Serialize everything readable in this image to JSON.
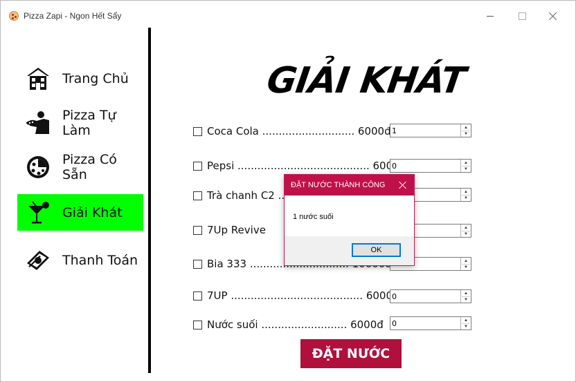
{
  "window": {
    "title": "Pizza Zapi - Ngon Hết Sẩy"
  },
  "sidebar": {
    "items": [
      {
        "label": "Trang Chủ",
        "icon": "house-icon",
        "active": false
      },
      {
        "label": "Pizza Tự Làm",
        "icon": "chef-icon",
        "active": false
      },
      {
        "label": "Pizza Có Sẵn",
        "icon": "pizza-icon",
        "active": false
      },
      {
        "label": "Giải Khát",
        "icon": "cocktail-icon",
        "active": true
      },
      {
        "label": "Thanh Toán",
        "icon": "money-icon",
        "active": false
      }
    ],
    "active_color": "#00ff00"
  },
  "main": {
    "heading": "GIẢI KHÁT",
    "drinks": [
      {
        "name": "Coca Cola",
        "text": "Coca Cola ............................ 6000đ",
        "qty": "1"
      },
      {
        "name": "Pepsi",
        "text": "Pepsi ........................................ 6000đ",
        "qty": "0"
      },
      {
        "name": "Trà chanh C2",
        "text": "Trà chanh C2 .......",
        "qty": ""
      },
      {
        "name": "7Up Revive",
        "text": "7Up Revive",
        "qty": ""
      },
      {
        "name": "Bia 333",
        "text": "Bia 333 .............................. 10000đ",
        "qty": ""
      },
      {
        "name": "7UP",
        "text": "7UP ........................................ 6000đ",
        "qty": "0"
      },
      {
        "name": "Nước suối",
        "text": "Nước suối .......................... 6000đ",
        "qty": "0"
      }
    ],
    "order_button": "ĐẶT NƯỚC",
    "order_button_color": "#b0103b"
  },
  "dialog": {
    "title": "ĐẶT NƯỚC THÀNH CÔNG",
    "message": "1 nước suối",
    "ok_label": "OK",
    "title_color": "#c0104a"
  }
}
